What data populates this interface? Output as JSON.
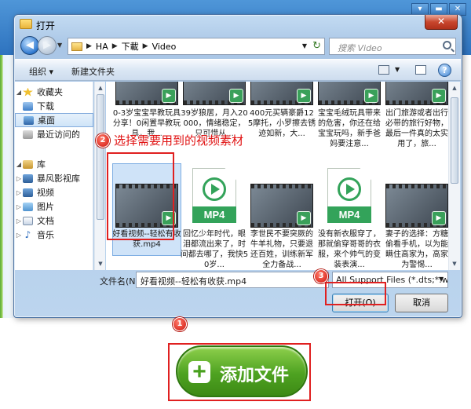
{
  "dialog": {
    "title": "打开",
    "close_label": "✕",
    "breadcrumb": [
      "HA",
      "下載",
      "Video"
    ],
    "search_placeholder": "搜索 Video",
    "toolbar": {
      "organize": "组织 ▾",
      "new_folder": "新建文件夹",
      "help": "?"
    },
    "nav": [
      {
        "label": "收藏夹",
        "icon": "favorites-star-icon",
        "level": 0
      },
      {
        "label": "下载",
        "icon": "downloads-folder-icon",
        "level": 1
      },
      {
        "label": "桌面",
        "icon": "desktop-icon",
        "level": 1,
        "selected": true
      },
      {
        "label": "最近访问的",
        "icon": "recent-places-icon",
        "level": 1
      },
      {
        "label": "库",
        "icon": "libraries-icon",
        "level": 0
      },
      {
        "label": "暴风影视库",
        "icon": "video-library-icon",
        "level": 1
      },
      {
        "label": "视频",
        "icon": "videos-icon",
        "level": 1
      },
      {
        "label": "图片",
        "icon": "pictures-icon",
        "level": 1
      },
      {
        "label": "文档",
        "icon": "documents-icon",
        "level": 1
      },
      {
        "label": "音乐",
        "icon": "music-icon",
        "level": 1
      }
    ],
    "files_row1": [
      {
        "name": "0-3岁宝宝早教玩具分享！0闲置早教玩具，我..."
      },
      {
        "name": "39岁狼居，月入20000，情绪稳定，只可惜从..."
      },
      {
        "name": "400元买辆豪爵125摩托，小罗擦去锈迹如新，大..."
      },
      {
        "name": "宝宝毛绒玩具带来的危害，你还在给宝宝玩吗，新手爸妈要注意..."
      },
      {
        "name": "出门旅游或者出行必带的旅行好物，最后一件真的太实用了，旅..."
      }
    ],
    "files_row2": [
      {
        "name": "好看视频--轻松有收获.mp4",
        "kind": "video",
        "selected": true
      },
      {
        "name": "回忆少年时代，眼泪都流出来了，时间都去哪了，我快50岁...",
        "kind": "mp4"
      },
      {
        "name": "李世民不要突厥的牛羊礼物，只要退还百姓，训练新军全力备战...",
        "kind": "video"
      },
      {
        "name": "没有新衣服穿了，那就偷穿哥哥的衣服，来个帅气的变装表演...",
        "kind": "mp4"
      },
      {
        "name": "妻子的选择：方糖偷看手机，以为能瞒住高家为，高家为警惕...",
        "kind": "video"
      }
    ],
    "filename_label": "文件名(N):",
    "filename_value": "好看视频--轻松有收获.mp4",
    "filter_value": "All Support Files (*.dts;*.web",
    "open_label": "打开(O)",
    "cancel_label": "取消"
  },
  "annotations": {
    "step1": "1",
    "step2": "2",
    "step3": "3",
    "step2_text": "选择需要用到的视频素材"
  },
  "app": {
    "add_file_label": "添加文件",
    "add_plus": "+",
    "win_min": "▾",
    "win_restore": "▬",
    "win_close": "✕"
  },
  "colors": {
    "annotation_red": "#e02020",
    "add_button_green": "#4ea221",
    "mp4_green": "#33a35a"
  }
}
